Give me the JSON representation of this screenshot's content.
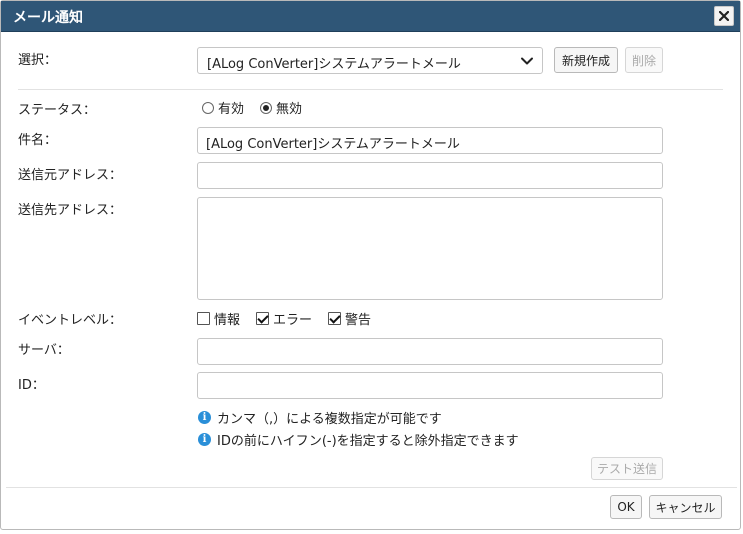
{
  "dialog": {
    "title": "メール通知",
    "close_label": "×"
  },
  "selection": {
    "label": "選択：",
    "selected": "[ALog ConVerter]システムアラートメール",
    "new_button": "新規作成",
    "delete_button": "削除"
  },
  "status": {
    "label": "ステータス：",
    "options": [
      {
        "label": "有効",
        "checked": false
      },
      {
        "label": "無効",
        "checked": true
      }
    ]
  },
  "subject": {
    "label": "件名：",
    "value": "[ALog ConVerter]システムアラートメール"
  },
  "from_address": {
    "label": "送信元アドレス：",
    "value": ""
  },
  "to_address": {
    "label": "送信先アドレス：",
    "value": ""
  },
  "event_level": {
    "label": "イベントレベル：",
    "options": [
      {
        "label": "情報",
        "checked": false
      },
      {
        "label": "エラー",
        "checked": true
      },
      {
        "label": "警告",
        "checked": true
      }
    ]
  },
  "server": {
    "label": "サーバ：",
    "value": ""
  },
  "id_field": {
    "label": "ID：",
    "value": ""
  },
  "info": {
    "icon_char": "i",
    "notes": [
      "カンマ（,）による複数指定が可能です",
      "IDの前にハイフン(-)を指定すると除外指定できます"
    ]
  },
  "buttons": {
    "test_send": "テスト送信",
    "ok": "OK",
    "cancel": "キャンセル"
  },
  "colors": {
    "titlebar": "#2f5677",
    "info_icon": "#2a8fd8"
  }
}
